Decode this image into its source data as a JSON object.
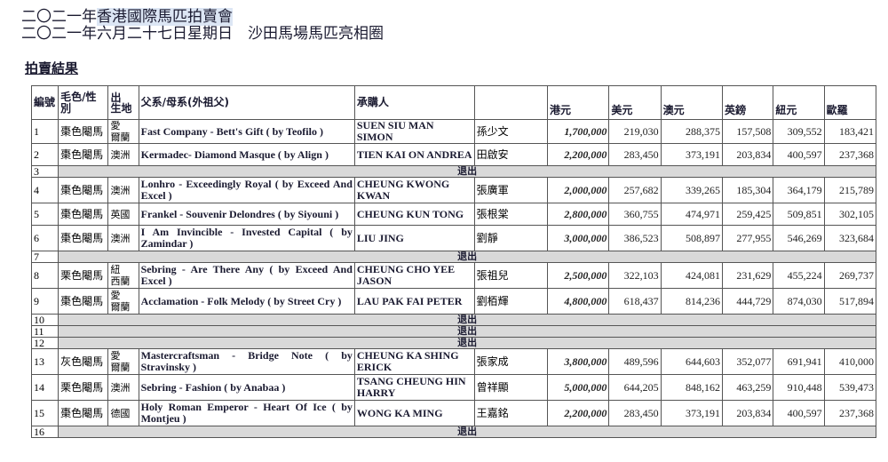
{
  "header": {
    "title_prefix": "二〇二一年",
    "title_highlight": "香港國際馬匹拍賣會",
    "subtitle": "二〇二一年六月二十七日星期日　沙田馬場馬匹亮相圈",
    "section": "拍賣結果"
  },
  "table": {
    "columns": {
      "lot": "編號",
      "colour_sex": "毛色/性別",
      "origin": "出　生地",
      "pedigree": "父系/母系(外祖父)",
      "buyer": "承購人",
      "buyer_cn": "",
      "hkd": "港元",
      "usd": "美元",
      "aud": "澳元",
      "gbp": "英鎊",
      "nzd": "紐元",
      "eur": "歐羅"
    },
    "withdrawn_label": "退出",
    "rows": [
      {
        "lot": "1",
        "colour_sex": "棗色閹馬",
        "origin": "愛　爾蘭",
        "pedigree": "Fast Company - Bett's Gift ( by Teofilo )",
        "buyer": "SUEN SIU MAN SIMON",
        "buyer_cn": "孫少文",
        "hkd": "1,700,000",
        "usd": "219,030",
        "aud": "288,375",
        "gbp": "157,508",
        "nzd": "309,552",
        "eur": "183,421"
      },
      {
        "lot": "2",
        "colour_sex": "棗色閹馬",
        "origin": "澳洲",
        "pedigree": "Kermadec- Diamond Masque ( by Align )",
        "buyer": "TIEN KAI ON ANDREA",
        "buyer_cn": "田啟安",
        "hkd": "2,200,000",
        "usd": "283,450",
        "aud": "373,191",
        "gbp": "203,834",
        "nzd": "400,597",
        "eur": "237,368"
      },
      {
        "lot": "3",
        "withdrawn": true
      },
      {
        "lot": "4",
        "colour_sex": "棗色閹馬",
        "origin": "澳洲",
        "pedigree": "Lonhro - Exceedingly Royal ( by Exceed And Excel )",
        "buyer": "CHEUNG KWONG KWAN",
        "buyer_cn": "張廣軍",
        "hkd": "2,000,000",
        "usd": "257,682",
        "aud": "339,265",
        "gbp": "185,304",
        "nzd": "364,179",
        "eur": "215,789"
      },
      {
        "lot": "5",
        "colour_sex": "棗色閹馬",
        "origin": "英國",
        "pedigree": "Frankel - Souvenir Delondres ( by Siyouni )",
        "buyer": "CHEUNG KUN TONG",
        "buyer_cn": "張根棠",
        "hkd": "2,800,000",
        "usd": "360,755",
        "aud": "474,971",
        "gbp": "259,425",
        "nzd": "509,851",
        "eur": "302,105"
      },
      {
        "lot": "6",
        "colour_sex": "棗色閹馬",
        "origin": "澳洲",
        "pedigree": "I Am Invincible - Invested Capital ( by Zamindar )",
        "buyer": "LIU JING",
        "buyer_cn": "劉靜",
        "hkd": "3,000,000",
        "usd": "386,523",
        "aud": "508,897",
        "gbp": "277,955",
        "nzd": "546,269",
        "eur": "323,684"
      },
      {
        "lot": "7",
        "withdrawn": true
      },
      {
        "lot": "8",
        "colour_sex": "栗色閹馬",
        "origin": "紐　西蘭",
        "pedigree": "Sebring - Are There Any ( by Exceed And Excel )",
        "buyer": "CHEUNG CHO YEE JASON",
        "buyer_cn": "張祖兒",
        "hkd": "2,500,000",
        "usd": "322,103",
        "aud": "424,081",
        "gbp": "231,629",
        "nzd": "455,224",
        "eur": "269,737"
      },
      {
        "lot": "9",
        "colour_sex": "棗色閹馬",
        "origin": "愛　爾蘭",
        "pedigree": "Acclamation - Folk Melody ( by Street Cry )",
        "buyer": "LAU PAK FAI PETER",
        "buyer_cn": "劉栢輝",
        "hkd": "4,800,000",
        "usd": "618,437",
        "aud": "814,236",
        "gbp": "444,729",
        "nzd": "874,030",
        "eur": "517,894"
      },
      {
        "lot": "10",
        "withdrawn": true
      },
      {
        "lot": "11",
        "withdrawn": true
      },
      {
        "lot": "12",
        "withdrawn": true
      },
      {
        "lot": "13",
        "colour_sex": "灰色閹馬",
        "origin": "愛　爾蘭",
        "pedigree": "Mastercraftsman - Bridge Note ( by Stravinsky )",
        "buyer": "CHEUNG KA SHING ERICK",
        "buyer_cn": "張家成",
        "hkd": "3,800,000",
        "usd": "489,596",
        "aud": "644,603",
        "gbp": "352,077",
        "nzd": "691,941",
        "eur": "410,000"
      },
      {
        "lot": "14",
        "colour_sex": "栗色閹馬",
        "origin": "澳洲",
        "pedigree": "Sebring - Fashion ( by Anabaa )",
        "buyer": "TSANG CHEUNG HIN HARRY",
        "buyer_cn": "曾祥顯",
        "hkd": "5,000,000",
        "usd": "644,205",
        "aud": "848,162",
        "gbp": "463,259",
        "nzd": "910,448",
        "eur": "539,473"
      },
      {
        "lot": "15",
        "colour_sex": "棗色閹馬",
        "origin": "德國",
        "pedigree": "Holy Roman Emperor - Heart Of Ice ( by Montjeu )",
        "buyer": "WONG KA MING",
        "buyer_cn": "王嘉銘",
        "hkd": "2,200,000",
        "usd": "283,450",
        "aud": "373,191",
        "gbp": "203,834",
        "nzd": "400,597",
        "eur": "237,368"
      },
      {
        "lot": "16",
        "withdrawn": true
      }
    ]
  }
}
